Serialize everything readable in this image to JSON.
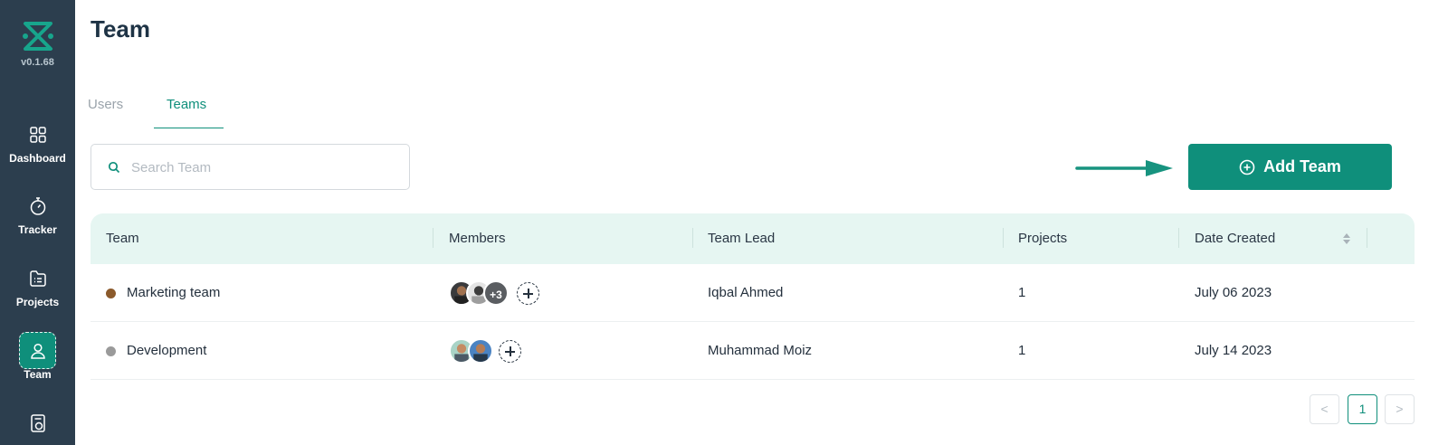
{
  "sidebar": {
    "version": "v0.1.68",
    "items": [
      {
        "label": "Dashboard",
        "icon": "grid-icon"
      },
      {
        "label": "Tracker",
        "icon": "stopwatch-icon"
      },
      {
        "label": "Projects",
        "icon": "list-icon"
      },
      {
        "label": "Team",
        "icon": "user-icon",
        "active": true
      },
      {
        "label": "",
        "icon": "invoice-icon"
      }
    ]
  },
  "header": {
    "title": "Team"
  },
  "tabs": [
    {
      "label": "Users"
    },
    {
      "label": "Teams",
      "active": true
    }
  ],
  "search": {
    "placeholder": "Search Team",
    "value": ""
  },
  "add_button": {
    "label": "Add Team"
  },
  "table": {
    "columns": [
      "Team",
      "Members",
      "Team Lead",
      "Projects",
      "Date Created"
    ],
    "rows": [
      {
        "team": "Marketing team",
        "dot_color": "#8b5a2b",
        "members_more": "+3",
        "lead": "Iqbal Ahmed",
        "projects": "1",
        "date": "July 06 2023"
      },
      {
        "team": "Development",
        "dot_color": "#9a9a9a",
        "members_more": "",
        "lead": "Muhammad Moiz",
        "projects": "1",
        "date": "July 14 2023"
      }
    ]
  },
  "pagination": {
    "prev": "<",
    "current": "1",
    "next": ">"
  },
  "colors": {
    "accent": "#0f8f7b",
    "sidebar": "#2c3e4e",
    "header_bg": "#e6f6f2"
  }
}
